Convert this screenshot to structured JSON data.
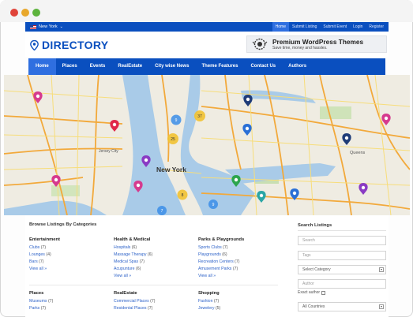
{
  "topbar": {
    "location": "New York",
    "links": [
      {
        "label": "Home",
        "active": true
      },
      {
        "label": "Submit Listing",
        "active": false
      },
      {
        "label": "Submit Event",
        "active": false
      },
      {
        "label": "Login",
        "active": false
      },
      {
        "label": "Register",
        "active": false
      }
    ]
  },
  "header": {
    "logo_text": "DIRECTORY",
    "ad_title": "Premium WordPress Themes",
    "ad_subtitle": "Save time, money and hassles."
  },
  "nav": [
    {
      "label": "Home",
      "active": true
    },
    {
      "label": "Places",
      "active": false
    },
    {
      "label": "Events",
      "active": false
    },
    {
      "label": "RealEstate",
      "active": false
    },
    {
      "label": "City wise News",
      "active": false
    },
    {
      "label": "Theme Features",
      "active": false
    },
    {
      "label": "Contact Us",
      "active": false
    },
    {
      "label": "Authors",
      "active": false
    }
  ],
  "map": {
    "city_label": "New York",
    "area_labels": [
      "Jersey City",
      "Queens"
    ],
    "cluster_counts": [
      "9",
      "37",
      "25",
      "8",
      "9",
      "7"
    ],
    "marker_colors": {
      "pink": "#d63a8e",
      "red": "#e0284a",
      "purple": "#8a3bc4",
      "blue": "#2a6fd6",
      "navy": "#1f3c78",
      "green": "#2ca54d",
      "teal": "#2aa6a6",
      "cluster": "#f1c232",
      "cluster_blue": "#3b8ee8"
    }
  },
  "listings": {
    "title": "Browse Listings By Categories",
    "categories": [
      {
        "title": "Entertainment",
        "items": [
          {
            "name": "Clubs",
            "count": "(7)"
          },
          {
            "name": "Lounges",
            "count": "(4)"
          },
          {
            "name": "Bars",
            "count": "(7)"
          }
        ],
        "view_all": "View all »"
      },
      {
        "title": "Health & Medical",
        "items": [
          {
            "name": "Hospitals",
            "count": "(6)"
          },
          {
            "name": "Massage Therapy",
            "count": "(6)"
          },
          {
            "name": "Medical Spas",
            "count": "(7)"
          },
          {
            "name": "Acupunture",
            "count": "(6)"
          }
        ],
        "view_all": "View all »"
      },
      {
        "title": "Parks & Playgrounds",
        "items": [
          {
            "name": "Sports Clubs",
            "count": "(7)"
          },
          {
            "name": "Playgrounds",
            "count": "(6)"
          },
          {
            "name": "Recreation Centers",
            "count": "(7)"
          },
          {
            "name": "Amusement Parks",
            "count": "(7)"
          }
        ],
        "view_all": "View all »"
      },
      {
        "title": "Places",
        "items": [
          {
            "name": "Museums",
            "count": "(7)"
          },
          {
            "name": "Parks",
            "count": "(7)"
          }
        ]
      },
      {
        "title": "RealEstate",
        "items": [
          {
            "name": "Commercial Places",
            "count": "(7)"
          },
          {
            "name": "Residental Places",
            "count": "(7)"
          }
        ]
      },
      {
        "title": "Shopping",
        "items": [
          {
            "name": "Fashion",
            "count": "(7)"
          },
          {
            "name": "Jewelery",
            "count": "(5)"
          }
        ]
      }
    ]
  },
  "search": {
    "title": "Search Listings",
    "search_placeholder": "Search",
    "tags_placeholder": "Tags",
    "category_label": "Select Category",
    "author_placeholder": "Author",
    "exact_author_label": "Exact author",
    "countries_label": "All Countries"
  }
}
